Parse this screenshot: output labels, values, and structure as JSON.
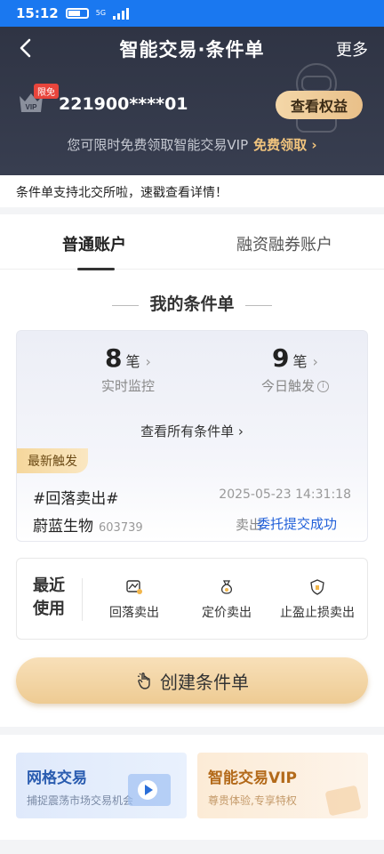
{
  "status_bar": {
    "time": "15:12",
    "network": "5G"
  },
  "header": {
    "title": "智能交易·条件单",
    "more_label": "更多",
    "limit_tag": "限免",
    "account_no": "221900****01",
    "benefit_button": "查看权益",
    "promo_text": "您可限时免费领取智能交易VIP",
    "promo_link": "免费领取 ›"
  },
  "notice": "条件单支持北交所啦，速戳查看详情！",
  "tabs": [
    {
      "label": "普通账户",
      "active": true
    },
    {
      "label": "融资融券账户",
      "active": false
    }
  ],
  "section_title": "我的条件单",
  "stats": {
    "monitoring": {
      "count": "8",
      "unit": "笔",
      "label": "实时监控"
    },
    "triggered": {
      "count": "9",
      "unit": "笔",
      "label": "今日触发"
    },
    "view_all": "查看所有条件单 ›"
  },
  "latest": {
    "tag": "最新触发",
    "condition": "#回落卖出#",
    "time": "2025-05-23 14:31:18",
    "stock_name": "蔚蓝生物",
    "stock_code": "603739",
    "side": "卖出",
    "status": "委托提交成功",
    "status_color": "#2160d9"
  },
  "recent": {
    "title": "最近使用",
    "items": [
      {
        "label": "回落卖出",
        "icon": "chart-down-icon"
      },
      {
        "label": "定价卖出",
        "icon": "money-bag-icon"
      },
      {
        "label": "止盈止损卖出",
        "icon": "shield-icon"
      }
    ]
  },
  "create_button": "创建条件单",
  "promos": [
    {
      "title": "网格交易",
      "subtitle": "捕捉震荡市场交易机会"
    },
    {
      "title": "智能交易VIP",
      "subtitle": "尊贵体验,专享特权"
    }
  ],
  "colors": {
    "accent_blue": "#1a78f0",
    "header_bg": "#2f3444",
    "gold": "#e9c089"
  }
}
